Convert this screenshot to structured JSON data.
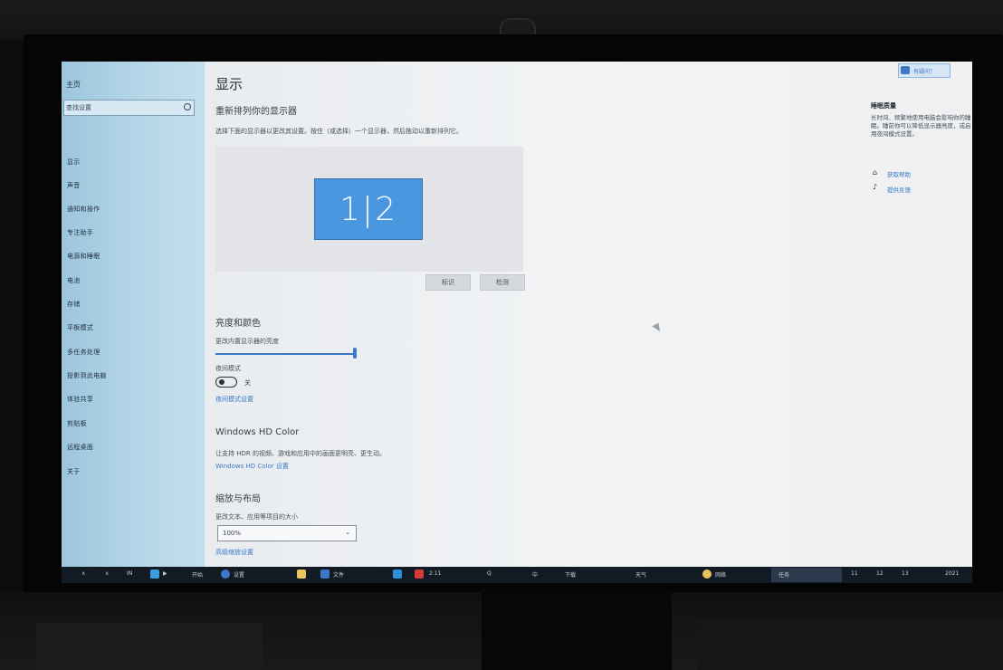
{
  "page": {
    "title": "显示",
    "section_display": "重新排列你的显示器",
    "section_display_desc": "选择下面的显示器以更改其设置。按住（或选择）一个显示器，然后拖动以重新排列它。",
    "monitor_label": "1|2",
    "buttons": {
      "identify": "标识",
      "detect": "检测"
    },
    "section_brightness": "亮度和颜色",
    "brightness_label": "更改内置显示器的亮度",
    "brightness_value": 0.99,
    "night_light_label": "夜间模式",
    "night_light_state": "关",
    "night_light_link": "夜间模式设置",
    "section_hdr": "Windows HD Color",
    "hdr_desc": "让支持 HDR 的视频、游戏和应用中的画面更明亮、更生动。",
    "hdr_link": "Windows HD Color 设置",
    "section_scale": "缩放与布局",
    "scale_label": "更改文本、应用等项目的大小",
    "scale_value": "100%",
    "scale_link": "高级缩放设置"
  },
  "sidebar": {
    "home": "主页",
    "search_placeholder": "查找设置",
    "items": [
      {
        "label": "显示"
      },
      {
        "label": "声音"
      },
      {
        "label": "通知和操作"
      },
      {
        "label": "专注助手"
      },
      {
        "label": "电源和睡眠"
      },
      {
        "label": "电池"
      },
      {
        "label": "存储"
      },
      {
        "label": "平板模式"
      },
      {
        "label": "多任务处理"
      },
      {
        "label": "投影到此电脑"
      },
      {
        "label": "体验共享"
      },
      {
        "label": "剪贴板"
      },
      {
        "label": "远程桌面"
      },
      {
        "label": "关于"
      }
    ]
  },
  "right_panel": {
    "top_button": "有疑问？",
    "heading": "睡眠质量",
    "text": "长时间、频繁地使用电脑会影响你的睡眠。睡前你可以降低显示器亮度，或启用夜间模式设置。",
    "links": [
      "获取帮助",
      "提供反馈"
    ]
  },
  "taskbar": {
    "items": [
      "∧",
      "∧",
      "IN",
      "▶",
      "开始",
      "设置",
      "资源管理器",
      "设置",
      "文件",
      "微信",
      "2:11",
      "Q",
      "中",
      "下载",
      "天气",
      "网络",
      "任务",
      "11",
      "12",
      "13"
    ],
    "clock": "2021"
  },
  "colors": {
    "accent": "#3c78c8",
    "sidebar": "#b7d8ea",
    "taskbar": "#121a24"
  }
}
